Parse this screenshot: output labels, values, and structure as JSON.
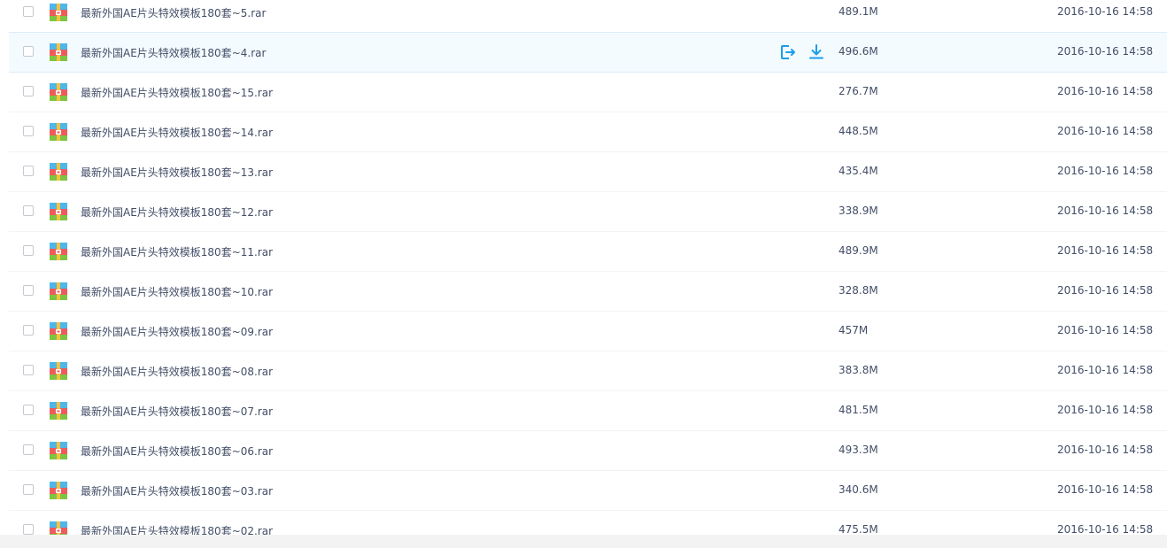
{
  "file_list": {
    "actions": {
      "share_icon": "share-icon",
      "download_icon": "download-icon",
      "accent_color": "#1a9eea"
    },
    "file_icon": "rar-archive-icon",
    "rows": [
      {
        "name": "最新外国AE片头特效模板180套~5.rar",
        "size": "489.1M",
        "date": "2016-10-16 14:58"
      },
      {
        "name": "最新外国AE片头特效模板180套~4.rar",
        "size": "496.6M",
        "date": "2016-10-16 14:58"
      },
      {
        "name": "最新外国AE片头特效模板180套~15.rar",
        "size": "276.7M",
        "date": "2016-10-16 14:58"
      },
      {
        "name": "最新外国AE片头特效模板180套~14.rar",
        "size": "448.5M",
        "date": "2016-10-16 14:58"
      },
      {
        "name": "最新外国AE片头特效模板180套~13.rar",
        "size": "435.4M",
        "date": "2016-10-16 14:58"
      },
      {
        "name": "最新外国AE片头特效模板180套~12.rar",
        "size": "338.9M",
        "date": "2016-10-16 14:58"
      },
      {
        "name": "最新外国AE片头特效模板180套~11.rar",
        "size": "489.9M",
        "date": "2016-10-16 14:58"
      },
      {
        "name": "最新外国AE片头特效模板180套~10.rar",
        "size": "328.8M",
        "date": "2016-10-16 14:58"
      },
      {
        "name": "最新外国AE片头特效模板180套~09.rar",
        "size": "457M",
        "date": "2016-10-16 14:58"
      },
      {
        "name": "最新外国AE片头特效模板180套~08.rar",
        "size": "383.8M",
        "date": "2016-10-16 14:58"
      },
      {
        "name": "最新外国AE片头特效模板180套~07.rar",
        "size": "481.5M",
        "date": "2016-10-16 14:58"
      },
      {
        "name": "最新外国AE片头特效模板180套~06.rar",
        "size": "493.3M",
        "date": "2016-10-16 14:58"
      },
      {
        "name": "最新外国AE片头特效模板180套~03.rar",
        "size": "340.6M",
        "date": "2016-10-16 14:58"
      },
      {
        "name": "最新外国AE片头特效模板180套~02.rar",
        "size": "475.5M",
        "date": "2016-10-16 14:58"
      }
    ]
  }
}
